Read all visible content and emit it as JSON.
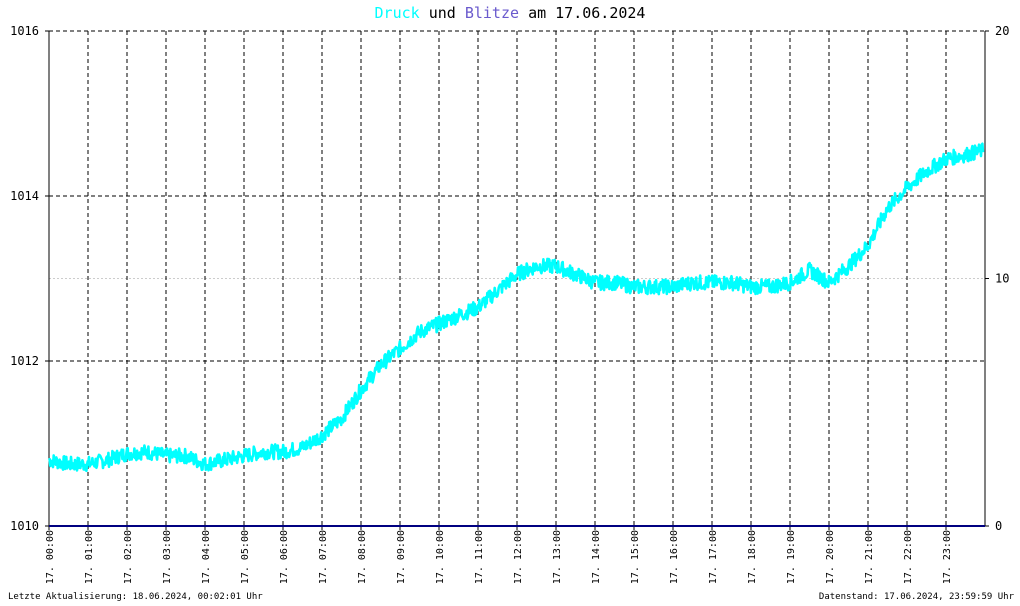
{
  "title": {
    "series1": "Druck",
    "connector": "und",
    "series2": "Blitze",
    "suffix": "am 17.06.2024"
  },
  "footer": {
    "left": "Letzte Aktualisierung: 18.06.2024, 00:02:01 Uhr",
    "right": "Datenstand: 17.06.2024, 23:59:59 Uhr"
  },
  "colors": {
    "druck": "#00ffff",
    "blitze": "#6a5acd",
    "grid": "#000000",
    "blitzeAxis": "#000080"
  },
  "chart_data": {
    "type": "line",
    "title": "Druck und Blitze am 17.06.2024",
    "xlabel": "",
    "ylabel": "",
    "y_left": {
      "ylim": [
        1010,
        1016
      ],
      "ticks": [
        1010,
        1012,
        1014,
        1016
      ]
    },
    "y_right": {
      "ylim": [
        0,
        20
      ],
      "ticks": [
        0,
        10,
        20
      ]
    },
    "x_ticks": [
      "17. 00:00",
      "17. 01:00",
      "17. 02:00",
      "17. 03:00",
      "17. 04:00",
      "17. 05:00",
      "17. 06:00",
      "17. 07:00",
      "17. 08:00",
      "17. 09:00",
      "17. 10:00",
      "17. 11:00",
      "17. 12:00",
      "17. 13:00",
      "17. 14:00",
      "17. 15:00",
      "17. 16:00",
      "17. 17:00",
      "17. 18:00",
      "17. 19:00",
      "17. 20:00",
      "17. 21:00",
      "17. 22:00",
      "17. 23:00"
    ],
    "grid": true,
    "series": [
      {
        "name": "Druck",
        "axis": "left",
        "x_hours": [
          0,
          0.5,
          1,
          1.5,
          2,
          2.5,
          3,
          3.5,
          4,
          4.5,
          5,
          5.5,
          6,
          6.5,
          7,
          7.5,
          8,
          8.5,
          9,
          9.5,
          10,
          10.5,
          11,
          11.5,
          12,
          12.5,
          13,
          13.5,
          14,
          14.5,
          15,
          15.5,
          16,
          16.5,
          17,
          17.5,
          18,
          18.5,
          19,
          19.5,
          20,
          20.5,
          21,
          21.5,
          22,
          22.5,
          23,
          23.5,
          23.95
        ],
        "values": [
          1010.8,
          1010.75,
          1010.75,
          1010.8,
          1010.88,
          1010.9,
          1010.85,
          1010.85,
          1010.75,
          1010.8,
          1010.85,
          1010.9,
          1010.9,
          1010.95,
          1011.1,
          1011.3,
          1011.65,
          1011.95,
          1012.15,
          1012.35,
          1012.45,
          1012.55,
          1012.65,
          1012.85,
          1013.05,
          1013.15,
          1013.15,
          1013.05,
          1012.95,
          1012.95,
          1012.9,
          1012.9,
          1012.9,
          1012.95,
          1012.95,
          1012.95,
          1012.9,
          1012.9,
          1012.95,
          1013.1,
          1012.95,
          1013.15,
          1013.4,
          1013.85,
          1014.1,
          1014.3,
          1014.45,
          1014.5,
          1014.55
        ],
        "noise": 0.09
      },
      {
        "name": "Blitze",
        "axis": "right",
        "x_hours": [
          0,
          24
        ],
        "values": [
          0,
          0
        ]
      }
    ]
  }
}
